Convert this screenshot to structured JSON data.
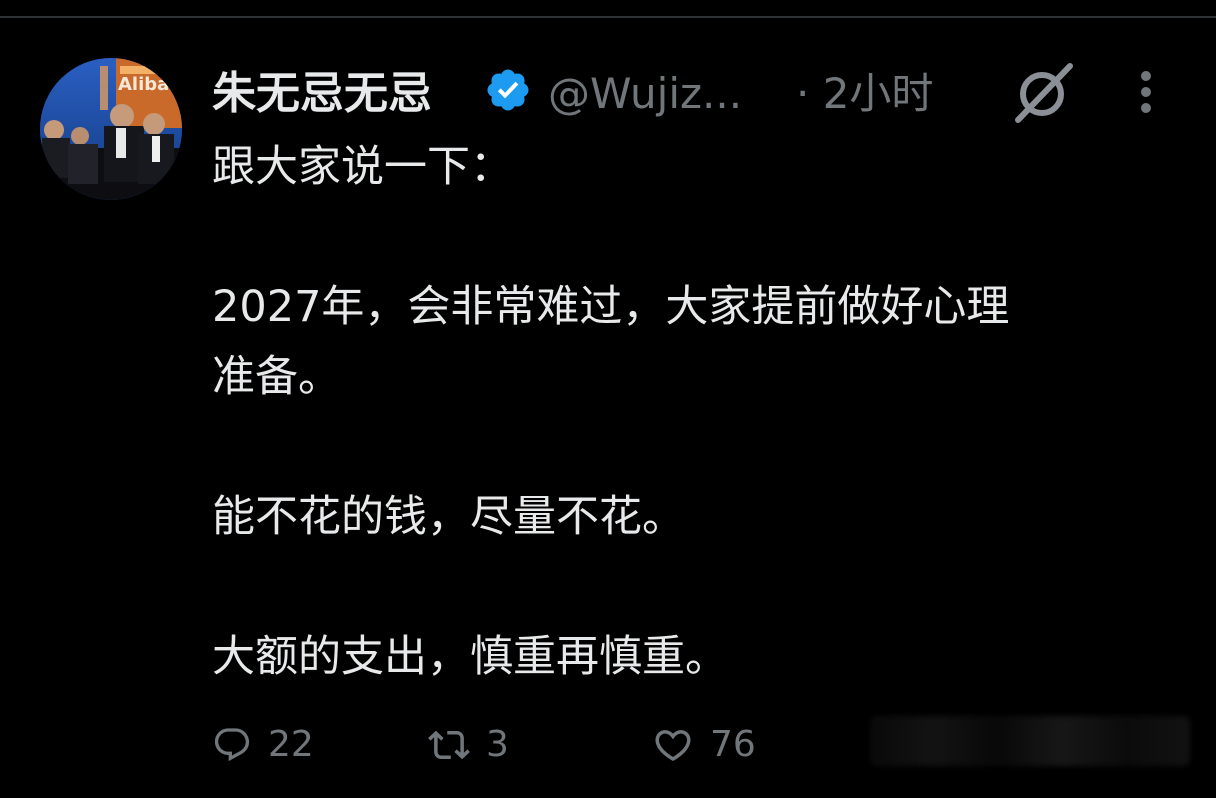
{
  "author": {
    "display_name": "朱无忌无忌",
    "handle": "@Wujiz...",
    "timestamp": "· 2小时",
    "verified": true,
    "avatar_sign_text": "Aliba"
  },
  "tweet": {
    "paragraphs": [
      "跟大家说一下：",
      "2027年，会非常难过，大家提前做好心理\n准备。",
      "能不花的钱，尽量不花。",
      "大额的支出，慎重再慎重。"
    ]
  },
  "actions": {
    "reply_count": "22",
    "retweet_count": "3",
    "like_count": "76"
  },
  "icons": {
    "verified": "verified-badge-icon",
    "grok": "grok-icon",
    "more": "more-options-icon",
    "reply": "reply-icon",
    "retweet": "retweet-icon",
    "like": "like-icon"
  },
  "colors": {
    "background": "#000000",
    "text_primary": "#e7e9ea",
    "text_secondary": "#71767b",
    "verified_blue": "#1d9bf0",
    "divider": "#2f3336"
  }
}
